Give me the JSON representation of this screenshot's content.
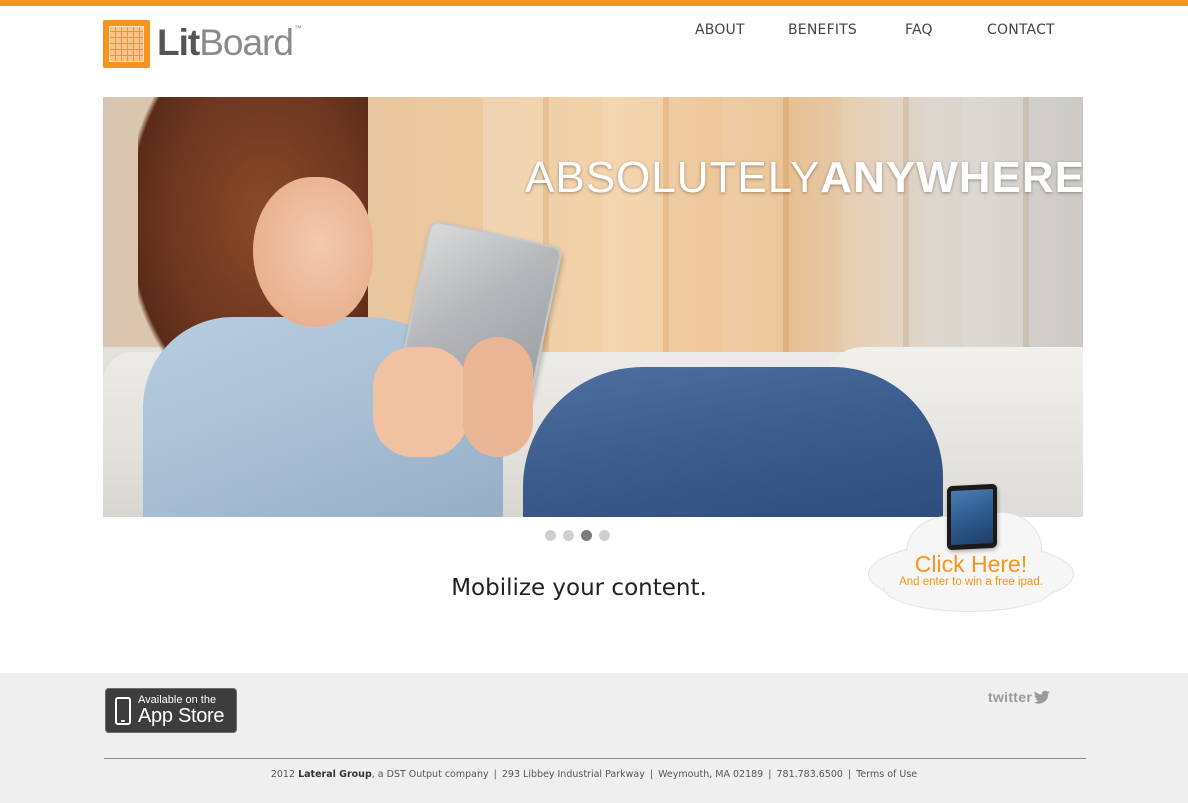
{
  "brand": {
    "name_bold": "Lit",
    "name_light": "Board",
    "trademark": "™",
    "accent_color": "#f7941d"
  },
  "nav": {
    "items": [
      {
        "label": "ABOUT"
      },
      {
        "label": "BENEFITS"
      },
      {
        "label": "FAQ"
      },
      {
        "label": "CONTACT"
      }
    ]
  },
  "hero": {
    "headline_light": "ABSOLUTELY",
    "headline_bold": "ANYWHERE",
    "slides": {
      "count": 4,
      "active": 3
    }
  },
  "tagline": "Mobilize your content.",
  "promo": {
    "title": "Click Here!",
    "subtitle": "And enter to win a free ipad."
  },
  "footer": {
    "appstore": {
      "line1": "Available on the",
      "line2": "App Store"
    },
    "twitter": "twitter",
    "copyright_year": "2012",
    "company": "Lateral Group",
    "company_suffix": ", a DST Output company",
    "address": "293 Libbey Industrial Parkway",
    "city": "Weymouth, MA 02189",
    "phone": "781.783.6500",
    "terms": "Terms of Use",
    "separator": "|"
  }
}
